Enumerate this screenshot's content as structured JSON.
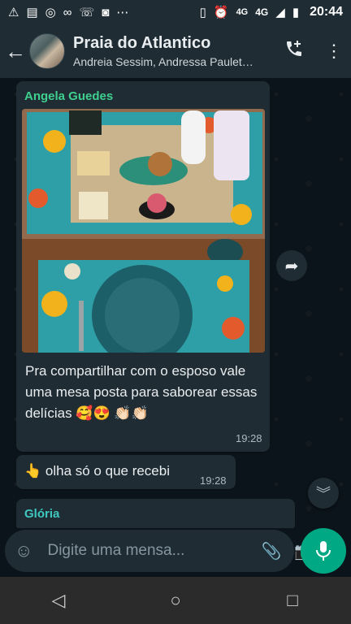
{
  "status_bar": {
    "time": "20:44",
    "network_a": "4G",
    "network_b": "4G",
    "icons": [
      "warning-icon",
      "news-icon",
      "chrome-icon",
      "voicemail-icon",
      "missed-call-icon",
      "instagram-icon",
      "more-dots-icon",
      "vibrate-icon",
      "alarm-icon",
      "signal-icon",
      "battery-icon"
    ]
  },
  "header": {
    "title": "Praia do Atlantico",
    "subtitle": "Andreia Sessim, Andressa Paulet…"
  },
  "messages": [
    {
      "sender": "Angela Guedes",
      "caption": "Pra compartilhar com o esposo vale uma mesa posta para saborear essas delícias 🥰😍 👏🏻👏🏻",
      "time": "19:28"
    },
    {
      "text": "👆 olha só o que recebi",
      "time": "19:28"
    },
    {
      "sender": "Glória"
    }
  ],
  "composer": {
    "placeholder": "Digite uma mensa..."
  },
  "colors": {
    "header_bg": "#1f2c34",
    "chat_bg": "#0b141a",
    "accent": "#00a884",
    "sender_green": "#3fcf8e",
    "sender_teal": "#3ec8c0"
  }
}
